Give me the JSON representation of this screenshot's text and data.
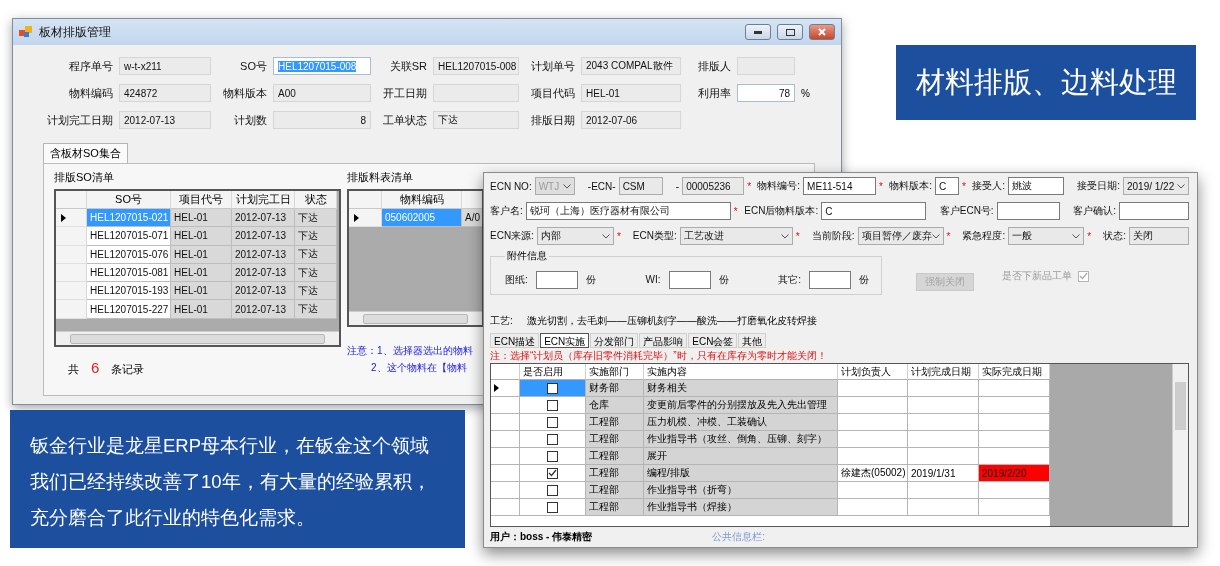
{
  "sheet_window": {
    "title": "板材排版管理",
    "form_rows": [
      [
        {
          "label": "程序单号",
          "value": "w-t-x211",
          "kind": "readonly"
        },
        {
          "label": "SO号",
          "value": "HEL1207015-008",
          "kind": "selected_input"
        },
        {
          "label": "关联SR",
          "value": "HEL1207015-008",
          "kind": "readonly"
        },
        {
          "label": "计划单号",
          "value": "2043 COMPAL散件",
          "kind": "readonly"
        },
        {
          "label": "排版人",
          "kind": "readonly"
        }
      ],
      [
        {
          "label": "物料编码",
          "value": "424872",
          "kind": "readonly"
        },
        {
          "label": "物料版本",
          "value": "A00",
          "kind": "readonly"
        },
        {
          "label": "开工日期",
          "kind": "readonly"
        },
        {
          "label": "项目代码",
          "value": "HEL-01",
          "kind": "readonly"
        },
        {
          "label": "利用率",
          "value": "78",
          "kind": "number_input",
          "suffix": "%"
        }
      ],
      [
        {
          "label": "计划完工日期",
          "value": "2012-07-13",
          "kind": "readonly"
        },
        {
          "label": "计划数",
          "value": "8",
          "kind": "number"
        },
        {
          "label": "工单状态",
          "value": "下达",
          "kind": "readonly"
        },
        {
          "label": "排版日期",
          "value": "2012-07-06",
          "kind": "readonly"
        }
      ]
    ],
    "tabs": [
      {
        "label": "含板材SO集合",
        "selected": true
      }
    ],
    "so_list": {
      "title": "排版SO清单",
      "columns": [
        "SO号",
        "项目代号",
        "计划完工日",
        "状态"
      ],
      "rows": [
        {
          "cells": [
            "HEL1207015-021",
            "HEL-01",
            "2012-07-13",
            "下达"
          ],
          "selected": true
        },
        {
          "cells": [
            "HEL1207015-071",
            "HEL-01",
            "2012-07-13",
            "下达"
          ],
          "selected": false
        },
        {
          "cells": [
            "HEL1207015-076",
            "HEL-01",
            "2012-07-13",
            "下达"
          ],
          "selected": false
        },
        {
          "cells": [
            "HEL1207015-081",
            "HEL-01",
            "2012-07-13",
            "下达"
          ],
          "selected": false
        },
        {
          "cells": [
            "HEL1207015-193",
            "HEL-01",
            "2012-07-13",
            "下达"
          ],
          "selected": false
        },
        {
          "cells": [
            "HEL1207015-227",
            "HEL-01",
            "2012-07-13",
            "下达"
          ],
          "selected": false
        }
      ]
    },
    "record_count": {
      "prefix": "共",
      "count": "6",
      "suffix": "条记录"
    },
    "material_list": {
      "title": "排版料表清单",
      "columns": [
        "物料编码"
      ],
      "rows": [
        {
          "cells": [
            "050602005",
            "A/0"
          ],
          "selected": true
        }
      ]
    },
    "notes": [
      "注意：1、选择器选出的物料",
      "2、这个物料在【物料"
    ]
  },
  "ecn_window": {
    "form_rows": [
      [
        {
          "label": "ECN NO:",
          "value": "WTJ",
          "kind": "combo",
          "disabled": true
        },
        {
          "label": "-ECN-",
          "value": "CSM",
          "kind": "readonly",
          "disabled": false
        },
        {
          "label": "-",
          "value": "00005236",
          "kind": "readonly",
          "disabled": false,
          "mark": "*"
        },
        {
          "label": "物料编号:",
          "value": "ME11-514",
          "kind": "input",
          "disabled": false,
          "mark": "*"
        },
        {
          "label": "物料版本:",
          "value": "C",
          "kind": "input",
          "disabled": false,
          "mark": "*"
        },
        {
          "label": "接受人:",
          "value": "姚波",
          "kind": "input",
          "disabled": false
        },
        {
          "label": "接受日期:",
          "value": "2019/ 1/22",
          "kind": "combo",
          "disabled": false
        }
      ],
      [
        {
          "label": "客户名:",
          "value": "锐珂（上海）医疗器材有限公司",
          "kind": "input",
          "disabled": false,
          "mark": "*"
        },
        {
          "label": "ECN后物料版本:",
          "value": "C",
          "kind": "input",
          "disabled": false
        },
        {
          "label": "客户ECN号:",
          "kind": "input",
          "disabled": false
        },
        {
          "label": "客户确认:",
          "kind": "input",
          "disabled": false
        }
      ],
      [
        {
          "label": "ECN来源:",
          "value": "内部",
          "kind": "combo",
          "disabled": false,
          "mark": "*"
        },
        {
          "label": "ECN类型:",
          "value": "工艺改进",
          "kind": "combo",
          "disabled": false,
          "mark": "*"
        },
        {
          "label": "当前阶段:",
          "value": "项目暂停／废弃",
          "kind": "combo",
          "disabled": false,
          "mark": "*"
        },
        {
          "label": "紧急程度:",
          "value": "一般",
          "kind": "combo",
          "disabled": false,
          "mark": "*"
        },
        {
          "label": "状态:",
          "value": "关闭",
          "kind": "readonly",
          "disabled": false
        }
      ]
    ],
    "attachments": {
      "title": "附件信息",
      "items": [
        {
          "label": "图纸:",
          "unit": "份"
        },
        {
          "label": "WI:",
          "unit": "份"
        },
        {
          "label": "其它:",
          "unit": "份"
        }
      ]
    },
    "force_close_button": {
      "label": "强制关闭",
      "disabled": true
    },
    "new_order_option": {
      "label": "是否下新品工单",
      "checked": true,
      "disabled": true
    },
    "process": {
      "label": "工艺:",
      "value": "激光切割，去毛刺——压铆机刻字——酸洗——打磨氧化皮转焊接"
    },
    "tabs": [
      {
        "label": "ECN描述",
        "selected": false
      },
      {
        "label": "ECN实施",
        "selected": true
      },
      {
        "label": "分发部门",
        "selected": false
      },
      {
        "label": "产品影响",
        "selected": false
      },
      {
        "label": "ECN会签",
        "selected": false
      },
      {
        "label": "其他",
        "selected": false
      }
    ],
    "warning": "注：选择“计划员（库存旧零件消耗完毕）”时，只有在库存为零时才能关闭！",
    "table": {
      "columns": [
        "是否启用",
        "实施部门",
        "实施内容",
        "计划负责人",
        "计划完成日期",
        "实际完成日期"
      ],
      "rows": [
        {
          "enabled": false,
          "department": "财务部",
          "content": "财务相关",
          "selected": true,
          "overdue": false
        },
        {
          "enabled": false,
          "department": "仓库",
          "content": "变更前后零件的分别摆放及先入先出管理",
          "selected": false,
          "overdue": false
        },
        {
          "enabled": false,
          "department": "工程部",
          "content": "压力机模、冲模、工装确认",
          "selected": false,
          "overdue": false
        },
        {
          "enabled": false,
          "department": "工程部",
          "content": "作业指导书（攻丝、倒角、压铆、刻字）",
          "selected": false,
          "overdue": false
        },
        {
          "enabled": false,
          "department": "工程部",
          "content": "展开",
          "selected": false,
          "overdue": false
        },
        {
          "enabled": true,
          "department": "工程部",
          "content": "编程/排版",
          "owner": "徐建杰(05002)",
          "plan_date": "2019/1/31",
          "actual_date": "2019/2/20",
          "selected": false,
          "overdue": true
        },
        {
          "enabled": false,
          "department": "工程部",
          "content": "作业指导书（折弯）",
          "selected": false,
          "overdue": false
        },
        {
          "enabled": false,
          "department": "工程部",
          "content": "作业指导书（焊接）",
          "selected": false,
          "overdue": false
        }
      ]
    },
    "status_bar": {
      "user": "用户：boss - 伟泰精密",
      "info_label": "公共信息栏:"
    }
  },
  "banner": {
    "title": "材料排版、边料处理"
  },
  "description": {
    "text": "钣金行业是龙星ERP母本行业，在钣金这个领域我们已经持续改善了10年，有大量的经验累积，充分磨合了此行业的特色化需求。"
  }
}
